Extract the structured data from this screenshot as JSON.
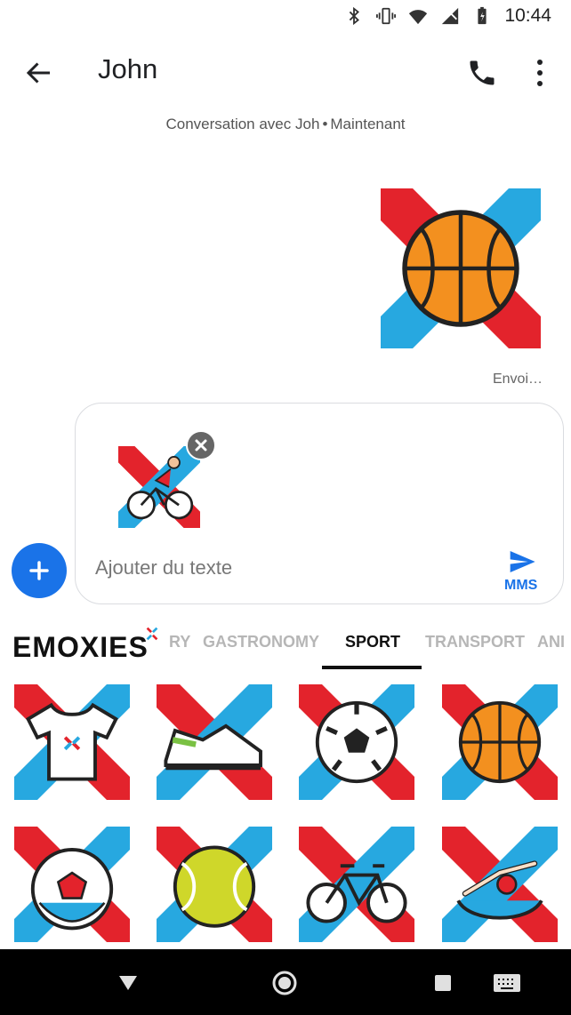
{
  "status_bar": {
    "time": "10:44",
    "icons": [
      "bluetooth-icon",
      "vibrate-icon",
      "wifi-icon",
      "no-signal-icon",
      "battery-icon"
    ]
  },
  "app_bar": {
    "title": "John",
    "icons": [
      "back-arrow-icon",
      "phone-icon",
      "more-vert-icon"
    ]
  },
  "conversation": {
    "subtitle_prefix": "Conversation avec",
    "subtitle_name": "Joh",
    "subtitle_dot": "•",
    "subtitle_time": "Maintenant",
    "sent_sticker": "basketball-sticker",
    "sent_status": "Envoi…"
  },
  "compose": {
    "attachment": "cyclist-sticker",
    "placeholder": "Ajouter du texte",
    "send_label": "MMS",
    "add_icon": "plus-icon",
    "remove_icon": "close-icon",
    "send_icon": "send-icon"
  },
  "sticker_panel": {
    "brand": "EMOXIES",
    "tabs": [
      {
        "label": "RY",
        "active": false
      },
      {
        "label": "GASTRONOMY",
        "active": false
      },
      {
        "label": "SPORT",
        "active": true
      },
      {
        "label": "TRANSPORT",
        "active": false
      },
      {
        "label": "ANI",
        "active": false
      }
    ],
    "stickers": [
      "tshirt-sticker",
      "sneaker-sticker",
      "soccer-ball-sticker",
      "basketball-sticker",
      "handball-sticker",
      "tennis-ball-sticker",
      "bicycle-sticker",
      "swimmer-sticker"
    ]
  },
  "colors": {
    "accent": "#1a73e8",
    "brand_red": "#e3232c",
    "brand_blue": "#27a8e0",
    "basketball": "#f3901f"
  },
  "nav_bar": {
    "icons": [
      "back-triangle-icon",
      "home-circle-icon",
      "recents-square-icon",
      "keyboard-icon"
    ]
  }
}
